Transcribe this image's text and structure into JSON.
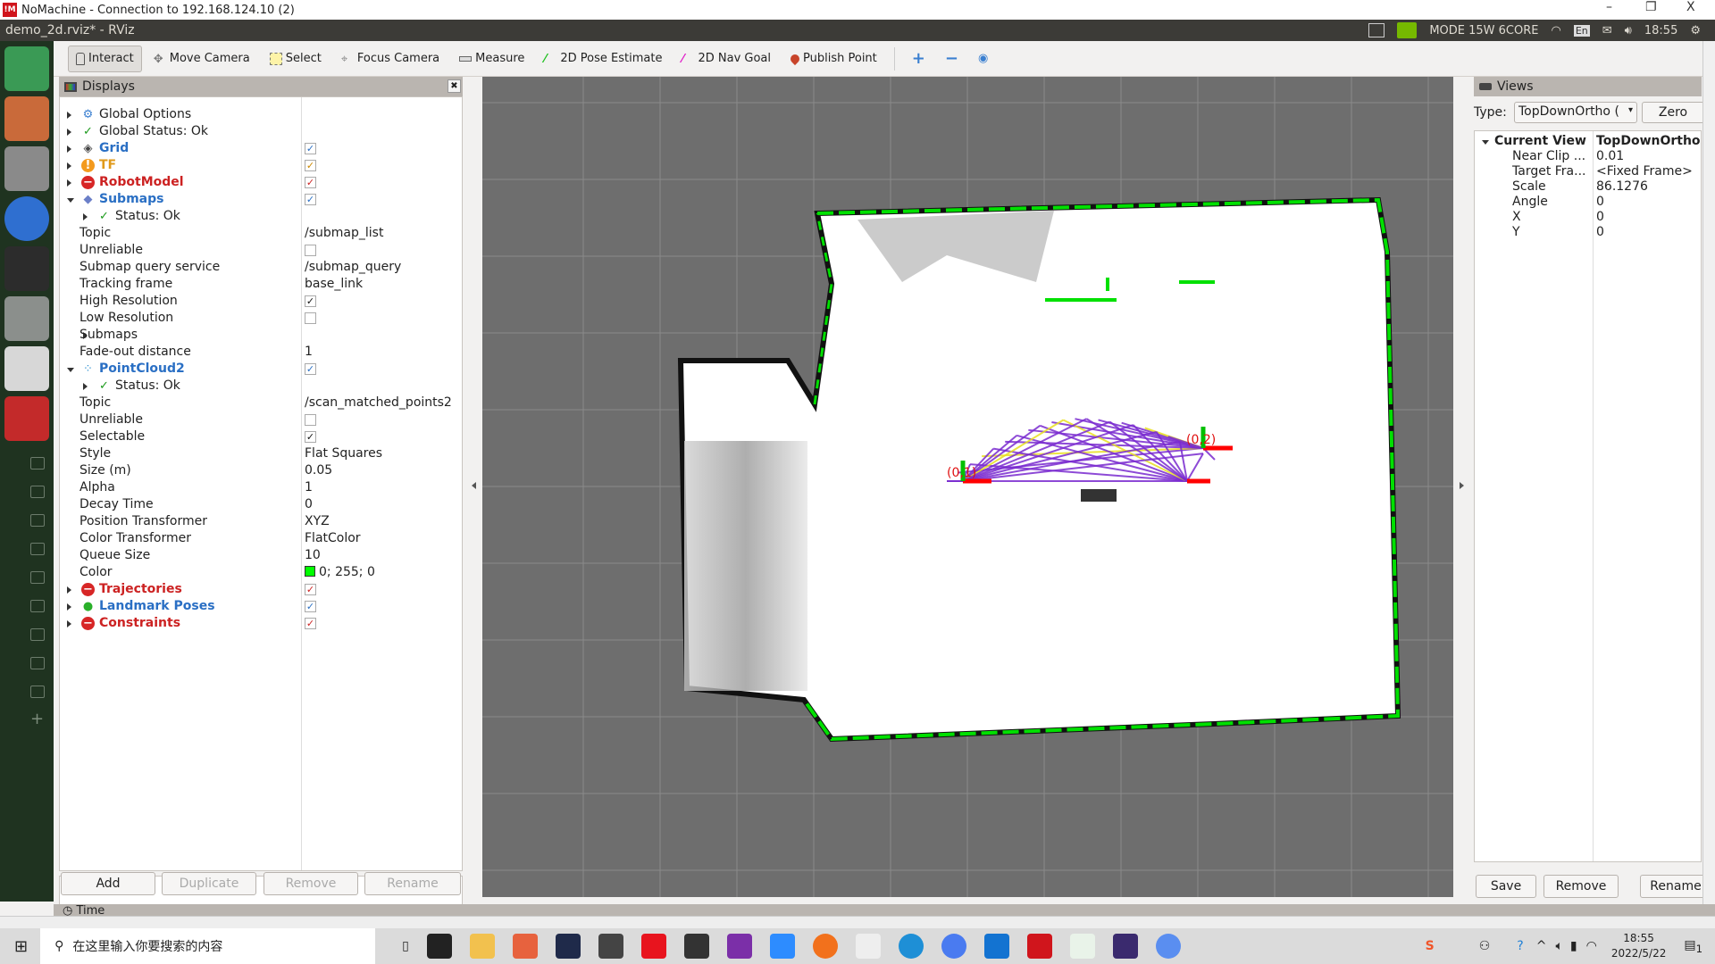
{
  "nomachine": {
    "title": "NoMachine - Connection to 192.168.124.10 (2)",
    "minimize": "–",
    "restore": "❐",
    "close": "X"
  },
  "topbar": {
    "window_title": "demo_2d.rviz* - RViz",
    "nvidia_mode": "MODE 15W 6CORE",
    "keyboard": "En",
    "clock": "18:55"
  },
  "toolbar": {
    "tools": [
      {
        "label": "Interact",
        "icon": "hand-icon",
        "active": true
      },
      {
        "label": "Move Camera",
        "icon": "move-camera-icon"
      },
      {
        "label": "Select",
        "icon": "select-icon"
      },
      {
        "label": "Focus Camera",
        "icon": "focus-camera-icon"
      },
      {
        "label": "Measure",
        "icon": "ruler-icon"
      },
      {
        "label": "2D Pose Estimate",
        "icon": "green-arrow-icon"
      },
      {
        "label": "2D Nav Goal",
        "icon": "pink-arrow-icon"
      },
      {
        "label": "Publish Point",
        "icon": "map-pin-icon"
      }
    ]
  },
  "displays": {
    "title": "Displays",
    "rows": [
      {
        "label": "Global Options",
        "value": ""
      },
      {
        "label": "Global Status: Ok",
        "value": ""
      },
      {
        "label": "Grid",
        "checked": true
      },
      {
        "label": "TF",
        "checked": true
      },
      {
        "label": "RobotModel",
        "checked": true
      },
      {
        "label": "Submaps",
        "checked": true
      },
      {
        "label": "Status: Ok"
      },
      {
        "label": "Topic",
        "value": "/submap_list"
      },
      {
        "label": "Unreliable",
        "checked": false
      },
      {
        "label": "Submap query service",
        "value": "/submap_query"
      },
      {
        "label": "Tracking frame",
        "value": "base_link"
      },
      {
        "label": "High Resolution",
        "checked": true
      },
      {
        "label": "Low Resolution",
        "checked": false
      },
      {
        "label": "Submaps"
      },
      {
        "label": "Fade-out distance",
        "value": "1"
      },
      {
        "label": "PointCloud2",
        "checked": true
      },
      {
        "label": "Status: Ok"
      },
      {
        "label": "Topic",
        "value": "/scan_matched_points2"
      },
      {
        "label": "Unreliable",
        "checked": false
      },
      {
        "label": "Selectable",
        "checked": true
      },
      {
        "label": "Style",
        "value": "Flat Squares"
      },
      {
        "label": "Size (m)",
        "value": "0.05"
      },
      {
        "label": "Alpha",
        "value": "1"
      },
      {
        "label": "Decay Time",
        "value": "0"
      },
      {
        "label": "Position Transformer",
        "value": "XYZ"
      },
      {
        "label": "Color Transformer",
        "value": "FlatColor"
      },
      {
        "label": "Queue Size",
        "value": "10"
      },
      {
        "label": "Color",
        "value": "0; 255; 0",
        "swatch": "#00ff00"
      },
      {
        "label": "Trajectories",
        "checked": true
      },
      {
        "label": "Landmark Poses",
        "checked": true
      },
      {
        "label": "Constraints",
        "checked": true
      }
    ],
    "buttons": {
      "add": "Add",
      "duplicate": "Duplicate",
      "remove": "Remove",
      "rename": "Rename"
    }
  },
  "viewport": {
    "background": "#6e6e6e",
    "free_space": "#ffffff",
    "wall_points": "#00e000",
    "scan_lines": "#7a2bd0",
    "pose_labels": [
      "(0,1)",
      "(0,2)"
    ]
  },
  "views": {
    "title": "Views",
    "type_label": "Type:",
    "type_value": "TopDownOrtho (",
    "zero": "Zero",
    "current_view": {
      "label": "Current View",
      "value": "TopDownOrtho ."
    },
    "props": [
      {
        "label": "Near Clip ...",
        "value": "0.01"
      },
      {
        "label": "Target Fra...",
        "value": "<Fixed Frame>"
      },
      {
        "label": "Scale",
        "value": "86.1276"
      },
      {
        "label": "Angle",
        "value": "0"
      },
      {
        "label": "X",
        "value": "0"
      },
      {
        "label": "Y",
        "value": "0"
      }
    ],
    "buttons": {
      "save": "Save",
      "remove": "Remove",
      "rename": "Rename"
    }
  },
  "time_panel": {
    "title": "Time"
  },
  "taskbar": {
    "search_placeholder": "在这里输入你要搜索的内容",
    "time": "18:55",
    "date": "2022/5/22",
    "notifications": "1"
  }
}
